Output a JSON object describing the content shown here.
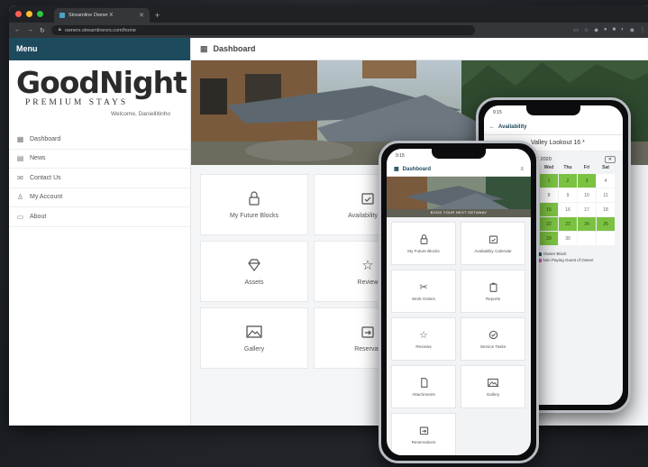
{
  "browser": {
    "tab_title": "Streamline Owner X",
    "url": "owners.streamlinevrs.com/home",
    "new_tab": "+",
    "close": "✕"
  },
  "sidebar": {
    "menu_label": "Menu",
    "logo_text": "GoodNight",
    "logo_subtitle": "PREMIUM STAYS",
    "welcome": "Welcome, Daniellitinho",
    "items": [
      {
        "label": "Dashboard",
        "icon": "grid-icon"
      },
      {
        "label": "News",
        "icon": "newspaper-icon"
      },
      {
        "label": "Contact Us",
        "icon": "mail-icon"
      },
      {
        "label": "My Account",
        "icon": "user-icon"
      },
      {
        "label": "About",
        "icon": "info-icon"
      }
    ]
  },
  "main": {
    "title": "Dashboard",
    "tiles": [
      {
        "label": "My Future Blocks",
        "icon": "lock-icon"
      },
      {
        "label": "Availability Ca",
        "icon": "calendar-check-icon"
      },
      {
        "label": "Assets",
        "icon": "diamond-icon"
      },
      {
        "label": "Review",
        "icon": "star-icon"
      },
      {
        "label": "Gallery",
        "icon": "image-icon"
      },
      {
        "label": "Reservati",
        "icon": "calendar-arrow-icon"
      }
    ]
  },
  "phone_calendar": {
    "time": "9:15",
    "title": "Availability",
    "property": "Valley Lookout 16 *",
    "month": "April 2020",
    "days": [
      "Wed",
      "Thu",
      "Fri",
      "Sat"
    ],
    "dates": [
      "1",
      "2",
      "3",
      "4",
      "8",
      "9",
      "10",
      "11",
      "15",
      "16",
      "17",
      "18",
      "22",
      "23",
      "24",
      "25",
      "29",
      "30",
      "",
      ""
    ],
    "green": [
      true,
      true,
      true,
      false,
      false,
      false,
      false,
      false,
      true,
      false,
      false,
      false,
      true,
      true,
      true,
      true,
      true,
      false,
      false,
      false
    ],
    "legend": [
      "Owner Block",
      "Non Paying Guest of Owner"
    ],
    "legend_left": "ner",
    "colors": {
      "owner": "#1e4a5e",
      "green": "#7cc242",
      "nonpaying": "#e04fb5"
    }
  },
  "phone_dashboard": {
    "time": "9:15",
    "title": "Dashboard",
    "hero_caption": "BOOK YOUR NEXT GETAWAY",
    "tiles": [
      {
        "label": "My Future Blocks",
        "icon": "lock-icon"
      },
      {
        "label": "Availability Calendar",
        "icon": "calendar-check-icon"
      },
      {
        "label": "Work Orders",
        "icon": "tools-icon"
      },
      {
        "label": "Reports",
        "icon": "clipboard-icon"
      },
      {
        "label": "Reviews",
        "icon": "star-icon"
      },
      {
        "label": "Service Tasks",
        "icon": "check-circle-icon"
      },
      {
        "label": "Attachments",
        "icon": "document-icon"
      },
      {
        "label": "Gallery",
        "icon": "image-icon"
      },
      {
        "label": "Reservations",
        "icon": "calendar-arrow-icon"
      }
    ]
  }
}
